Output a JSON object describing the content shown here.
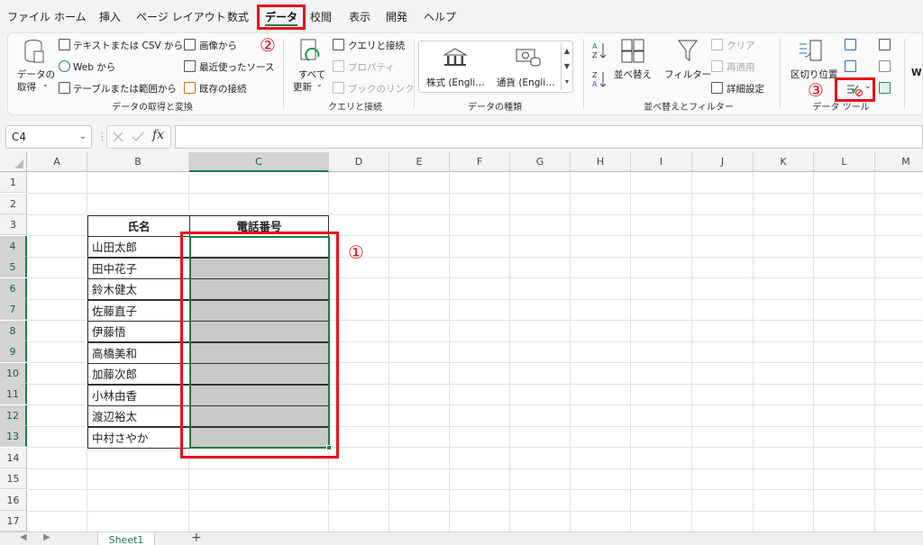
{
  "menu": {
    "tabs": [
      "ファイル",
      "ホーム",
      "挿入",
      "ページ レイアウト",
      "数式",
      "データ",
      "校閲",
      "表示",
      "開発",
      "ヘルプ"
    ],
    "active": "データ"
  },
  "ribbon": {
    "get_data": {
      "big_label_1": "データの",
      "big_label_2": "取得",
      "items": [
        "テキストまたは CSV から",
        "Web から",
        "テーブルまたは範囲から"
      ],
      "items2": [
        "画像から",
        "最近使ったソース",
        "既存の接続"
      ],
      "group_label": "データの取得と変換"
    },
    "queries": {
      "big_label_1": "すべて",
      "big_label_2": "更新",
      "items": [
        "クエリと接続",
        "プロパティ",
        "ブックのリンク"
      ],
      "group_label": "クエリと接続"
    },
    "datatypes": {
      "items": [
        "株式 (Engli…",
        "通貨 (Engli…"
      ],
      "group_label": "データの種類"
    },
    "sort": {
      "sort_label": "並べ替え",
      "filter_label": "フィルター",
      "items": [
        "クリア",
        "再適用",
        "詳細設定"
      ],
      "group_label": "並べ替えとフィルター"
    },
    "tools": {
      "split_label": "区切り位置",
      "group_label": "データ ツール",
      "extra_label": "Wh"
    }
  },
  "annotations": {
    "n1": "①",
    "n2": "②",
    "n3": "③"
  },
  "formula_bar": {
    "name_box": "C4",
    "fx": "fx",
    "value": ""
  },
  "columns": [
    "A",
    "B",
    "C",
    "D",
    "E",
    "F",
    "G",
    "H",
    "I",
    "J",
    "K",
    "L",
    "M"
  ],
  "rows": [
    "1",
    "2",
    "3",
    "4",
    "5",
    "6",
    "7",
    "8",
    "9",
    "10",
    "11",
    "12",
    "13",
    "14",
    "15",
    "16",
    "17"
  ],
  "table": {
    "header_name": "氏名",
    "header_phone": "電話番号",
    "names": [
      "山田太郎",
      "田中花子",
      "鈴木健太",
      "佐藤直子",
      "伊藤悟",
      "高橋美和",
      "加藤次郎",
      "小林由香",
      "渡辺裕太",
      "中村さやか"
    ]
  },
  "sheet_tab": "Sheet1",
  "colors": {
    "accent": "#1f7a44",
    "highlight": "#e8101a",
    "selection_fill": "#c9c9c9"
  }
}
